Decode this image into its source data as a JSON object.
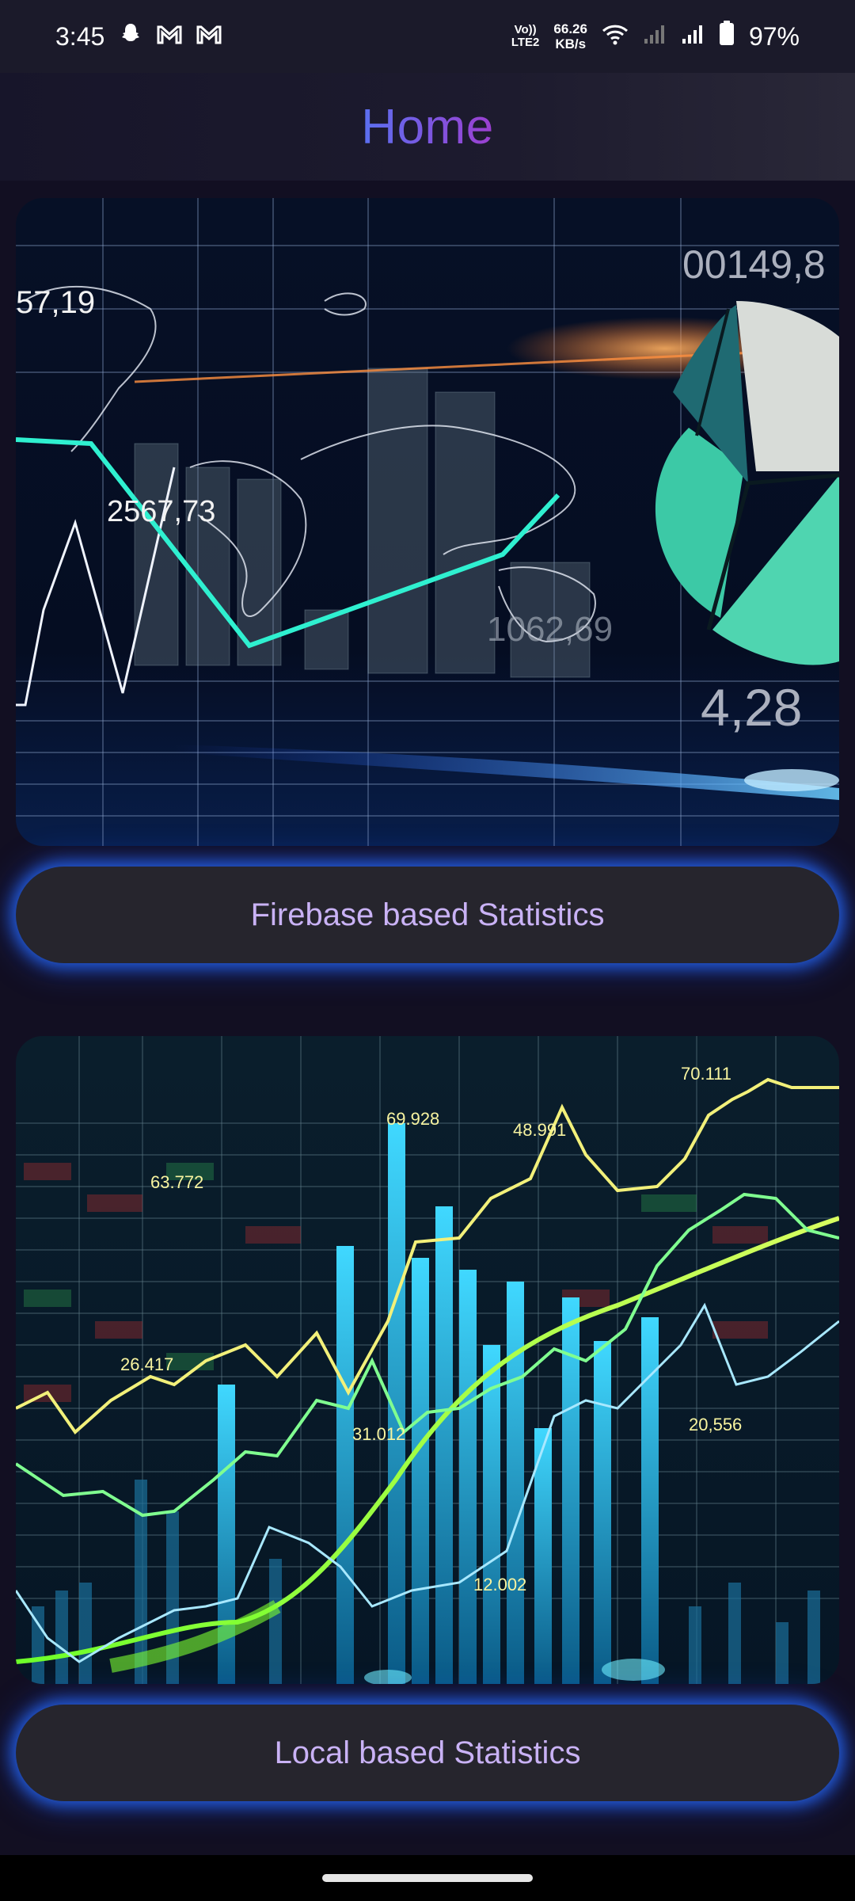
{
  "status_bar": {
    "time": "3:45",
    "volte_top": "Vo))",
    "volte_bottom": "LTE2",
    "speed_value": "66.26",
    "speed_unit": "KB/s",
    "battery": "97%",
    "icons": [
      "snapchat-icon",
      "gmail-icon",
      "gmail-icon",
      "wifi-icon",
      "signal-weak-icon",
      "signal-icon",
      "battery-icon"
    ]
  },
  "header": {
    "title": "Home"
  },
  "card1": {
    "labels": {
      "a": "57,19",
      "b": "2567,73",
      "c": "00149,8",
      "d": "1062,69",
      "e": "4,28"
    }
  },
  "button1": {
    "label": "Firebase based Statistics"
  },
  "card2": {
    "labels": {
      "a": "70.111",
      "b": "69.928",
      "c": "48.991",
      "d": "63.772",
      "e": "26.417",
      "f": "31.012",
      "g": "20,556",
      "h": "12.002"
    }
  },
  "button2": {
    "label": "Local based Statistics"
  },
  "colors": {
    "accent_glow": "#2a6bff",
    "button_text": "#c9b2f5",
    "title_gradient_start": "#5a70f0",
    "title_gradient_end": "#9c3fd0"
  }
}
